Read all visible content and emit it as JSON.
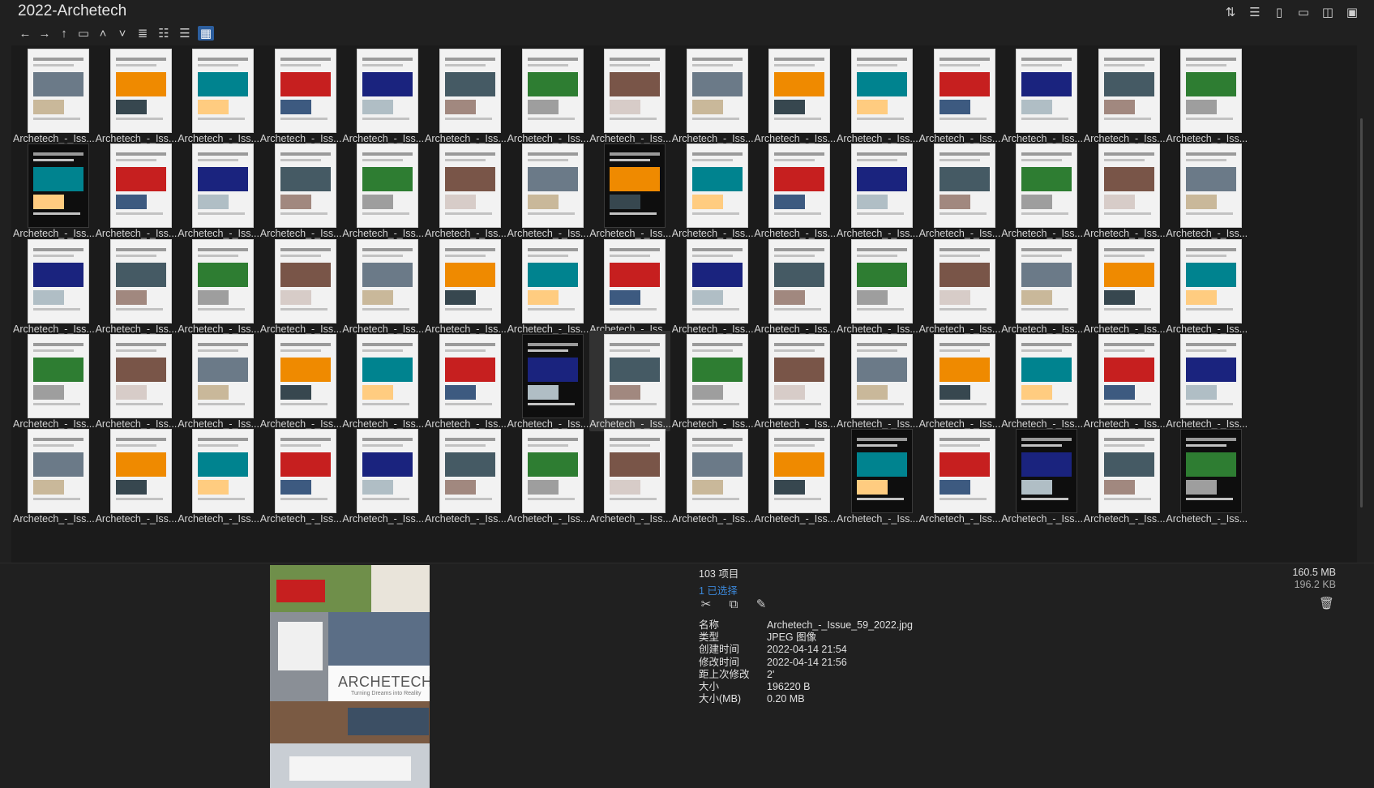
{
  "window": {
    "title": "2022-Archetech"
  },
  "toolbar": {
    "right_icons": [
      "sort-icon",
      "details-list-icon",
      "new-file-icon",
      "new-folder-icon",
      "preview-pane-icon",
      "clipboard-icon"
    ],
    "nav_icons": [
      "back-arrow-icon",
      "forward-arrow-icon",
      "up-arrow-icon",
      "folder-icon",
      "chevron-up-icon",
      "chevron-down-icon"
    ],
    "view_icons": [
      "list-view-icon",
      "details-view-icon",
      "tiles-view-icon",
      "thumbnails-view-icon"
    ]
  },
  "grid": {
    "caption": "Archetech_-_Iss...",
    "rows": 5,
    "cols": 15,
    "selected_index": 52
  },
  "status": {
    "item_count": "103 项目",
    "selected_count": "1 已选择",
    "total_size": "160.5 MB",
    "selected_size": "196.2 KB"
  },
  "preview": {
    "logo_text": "ARCHETECH",
    "logo_sub": "Turning Dreams into Reality"
  },
  "details": {
    "rows": [
      {
        "key": "名称",
        "value": "Archetech_-_Issue_59_2022.jpg"
      },
      {
        "key": "类型",
        "value": "JPEG 图像"
      },
      {
        "key": "创建时间",
        "value": "2022-04-14  21:54"
      },
      {
        "key": "修改时间",
        "value": "2022-04-14  21:56"
      },
      {
        "key": "距上次修改",
        "value": "2'"
      },
      {
        "key": "大小",
        "value": "196220 B"
      },
      {
        "key": "大小(MB)",
        "value": "0.20 MB"
      }
    ]
  },
  "colors": {
    "accent": "#2c5e9e",
    "selected_text": "#3b87d8"
  }
}
